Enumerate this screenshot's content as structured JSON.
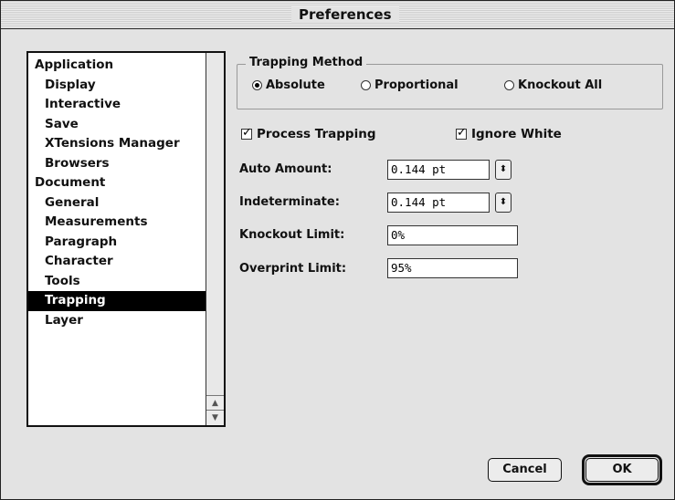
{
  "window": {
    "title": "Preferences"
  },
  "sidebar": {
    "items": [
      {
        "label": "Application",
        "level": 0,
        "selected": false
      },
      {
        "label": "Display",
        "level": 1,
        "selected": false
      },
      {
        "label": "Interactive",
        "level": 1,
        "selected": false
      },
      {
        "label": "Save",
        "level": 1,
        "selected": false
      },
      {
        "label": "XTensions Manager",
        "level": 1,
        "selected": false
      },
      {
        "label": "Browsers",
        "level": 1,
        "selected": false
      },
      {
        "label": "Document",
        "level": 0,
        "selected": false
      },
      {
        "label": "General",
        "level": 1,
        "selected": false
      },
      {
        "label": "Measurements",
        "level": 1,
        "selected": false
      },
      {
        "label": "Paragraph",
        "level": 1,
        "selected": false
      },
      {
        "label": "Character",
        "level": 1,
        "selected": false
      },
      {
        "label": "Tools",
        "level": 1,
        "selected": false
      },
      {
        "label": "Trapping",
        "level": 1,
        "selected": true
      },
      {
        "label": "Layer",
        "level": 1,
        "selected": false
      }
    ],
    "scroll_up_icon": "triangle-up",
    "scroll_down_icon": "triangle-down"
  },
  "trapping": {
    "method_label": "Trapping Method",
    "methods": [
      {
        "label": "Absolute",
        "selected": true
      },
      {
        "label": "Proportional",
        "selected": false
      },
      {
        "label": "Knockout All",
        "selected": false
      }
    ],
    "process_trapping": {
      "label": "Process Trapping",
      "checked": true
    },
    "ignore_white": {
      "label": "Ignore White",
      "checked": true
    },
    "auto_amount": {
      "label": "Auto Amount:",
      "value": "0.144 pt"
    },
    "indeterminate": {
      "label": "Indeterminate:",
      "value": "0.144 pt"
    },
    "knockout_limit": {
      "label": "Knockout Limit:",
      "value": "0%"
    },
    "overprint_limit": {
      "label": "Overprint Limit:",
      "value": "95%"
    }
  },
  "buttons": {
    "cancel": "Cancel",
    "ok": "OK"
  }
}
